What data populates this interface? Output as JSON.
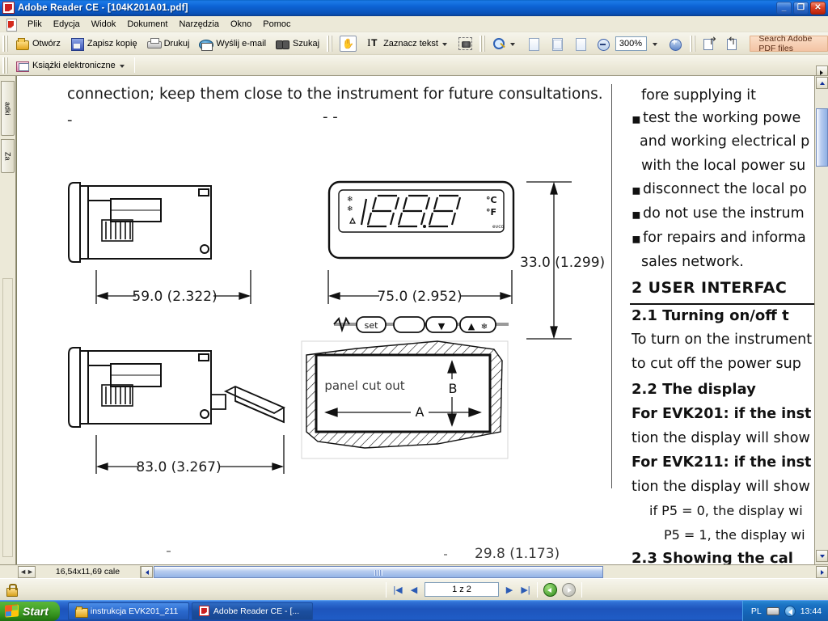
{
  "window": {
    "title": "Adobe Reader CE - [104K201A01.pdf]",
    "icon": "acrobat-icon",
    "buttons": {
      "minimize": "_",
      "maximize": "❐",
      "close": "✕"
    }
  },
  "menubar": {
    "items": [
      "Plik",
      "Edycja",
      "Widok",
      "Dokument",
      "Narzędzia",
      "Okno",
      "Pomoc"
    ]
  },
  "toolbar": {
    "open_label": "Otwórz",
    "save_label": "Zapisz kopię",
    "print_label": "Drukuj",
    "mail_label": "Wyślij e-mail",
    "search_label": "Szukaj",
    "select_text_label": "Zaznacz tekst",
    "zoom_value": "300%",
    "search_adobe_label": "Search Adobe PDF files",
    "ebooks_label": "Książki elektroniczne"
  },
  "navpane": {
    "tabs": [
      "adki",
      "Za"
    ]
  },
  "document": {
    "top_line": "connection; keep them close to the instrument for future consultations.",
    "dim_width_front": "59.0 (2.322)",
    "dim_width_panel": "75.0 (2.952)",
    "dim_height_panel": "33.0 (1.299)",
    "dim_depth": "83.0 (3.267)",
    "dim_bottom": "29.8 (1.173)",
    "cutout_label": "panel cut out",
    "cutout_a": "A",
    "cutout_b": "B",
    "display": {
      "set_key": "set",
      "down_key": "▼",
      "up_key": "▲",
      "unit_c": "°C",
      "unit_f": "°F",
      "digits": "1888",
      "brand": "evco"
    },
    "right_column": [
      {
        "text": "fore supplying it",
        "bold": false,
        "bullet": false
      },
      {
        "text": "test the working powe",
        "bold": false,
        "bullet": true
      },
      {
        "text": "and working electrical p",
        "bold": false,
        "bullet": false
      },
      {
        "text": "with the local power su",
        "bold": false,
        "bullet": false
      },
      {
        "text": "disconnect the local po",
        "bold": false,
        "bullet": true
      },
      {
        "text": "do not use the instrum",
        "bold": false,
        "bullet": true
      },
      {
        "text": "for repairs and informa",
        "bold": false,
        "bullet": true
      },
      {
        "text": "sales network.",
        "bold": false,
        "bullet": false
      },
      {
        "text": "2     USER INTERFAC",
        "bold": true,
        "bullet": false
      },
      {
        "text": "2.1  Turning on/off t",
        "bold": true,
        "bullet": false
      },
      {
        "text": "To turn on the instrument",
        "bold": false,
        "bullet": false
      },
      {
        "text": "to cut off the power sup",
        "bold": false,
        "bullet": false
      },
      {
        "text": "2.2  The display",
        "bold": true,
        "bullet": false
      },
      {
        "text": "For EVK201: if the inst",
        "bold": true,
        "bullet": false
      },
      {
        "text": "tion the display will show",
        "bold": false,
        "bullet": false
      },
      {
        "text": "For EVK211: if the inst",
        "bold": true,
        "bullet": false
      },
      {
        "text": "tion the display will show",
        "bold": false,
        "bullet": false
      },
      {
        "text": "if P5 = 0, the display wi",
        "bold": false,
        "bullet": false
      },
      {
        "text": "P5 = 1, the display wi",
        "bold": false,
        "bullet": false
      },
      {
        "text": "2.3  Showing the cal",
        "bold": true,
        "bullet": false
      }
    ]
  },
  "statusbar": {
    "page_size": "16,54x11,69 cale"
  },
  "navigation": {
    "page_value": "1 z 2",
    "first_label": "|◀",
    "prev_label": "◀",
    "next_label": "▶",
    "last_label": "▶|"
  },
  "taskbar": {
    "start_label": "Start",
    "tasks": [
      {
        "label": "instrukcja EVK201_211",
        "icon": "folder-icon",
        "active": false
      },
      {
        "label": "Adobe Reader CE - [...",
        "icon": "acrobat-icon",
        "active": true
      }
    ],
    "tray": {
      "language": "PL",
      "clock": "13:44"
    }
  },
  "colors": {
    "title_blue": "#0d63d4",
    "chrome": "#ece9d8",
    "taskbar_blue": "#1e54bb",
    "start_green": "#43a32a",
    "search_peach": "#f3c3a4",
    "close_red": "#e04425"
  }
}
